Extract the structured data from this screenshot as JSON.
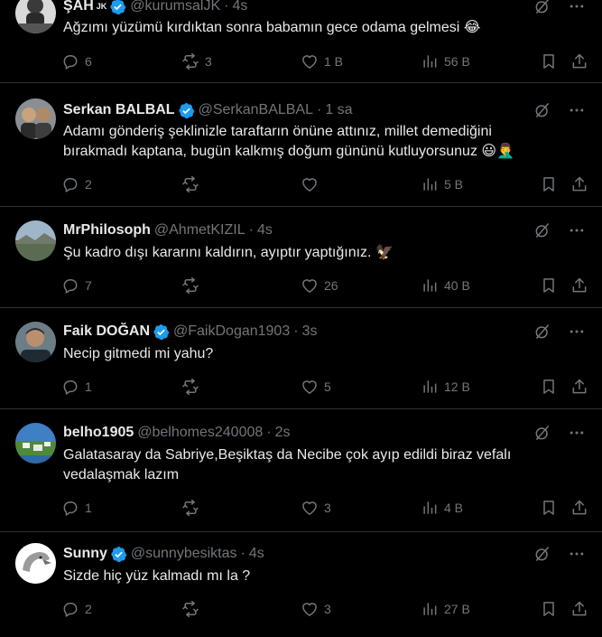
{
  "colors": {
    "background": "#000000",
    "text": "#e7e9ea",
    "muted": "#71767b",
    "verified": "#1d9bf0",
    "divider": "#2f3336"
  },
  "tweets": [
    {
      "name": "ŞAH",
      "name_badge": "JK",
      "handle": "@kurumsalJK",
      "time": "4s",
      "lines": [
        "Ağzımı yüzümü kırdıktan sonra babamın gece odama gelmesi 😂"
      ],
      "replies": "6",
      "retweets": "3",
      "likes": "1 B",
      "views": "56 B",
      "avatar_icon": "bearded-man-avatar"
    },
    {
      "name": "Serkan BALBAL",
      "handle": "@SerkanBALBAL",
      "time": "1 sa",
      "lines": [
        "Adamı gönderiş şeklinizle taraftarın önüne attınız, millet demediğini",
        "bırakmadı kaptana, bugün kalkmış doğum gününü kutluyorsunuz 😃🤦‍♂️"
      ],
      "replies": "2",
      "retweets": "",
      "likes": "",
      "views": "5 B",
      "avatar_icon": "two-men-avatar"
    },
    {
      "name": "MrPhilosoph",
      "handle": "@AhmetKIZIL",
      "time": "4s",
      "lines": [
        "Şu kadro dışı kararını kaldırın, ayıptır yaptığınız. 🦅"
      ],
      "replies": "7",
      "retweets": "",
      "likes": "26",
      "views": "40 B",
      "avatar_icon": "landscape-avatar"
    },
    {
      "name": "Faik DOĞAN",
      "handle": "@FaikDogan1903",
      "time": "3s",
      "lines": [
        "Necip gitmedi mi yahu?"
      ],
      "replies": "1",
      "retweets": "",
      "likes": "5",
      "views": "12 B",
      "avatar_icon": "man-portrait-avatar"
    },
    {
      "name": "belho1905",
      "handle": "@belhomes240008",
      "time": "2s",
      "lines": [
        "Galatasaray da Sabriye,Beşiktaş da Necibe çok ayıp edildi biraz vefalı",
        "vedalaşmak lazım"
      ],
      "replies": "1",
      "retweets": "",
      "likes": "3",
      "views": "4 B",
      "avatar_icon": "coastal-town-avatar"
    },
    {
      "name": "Sunny",
      "handle": "@sunnybesiktas",
      "time": "4s",
      "lines": [
        "Sizde hiç yüz kalmadı mı la ?"
      ],
      "replies": "2",
      "retweets": "",
      "likes": "3",
      "views": "27 B",
      "avatar_icon": "eagle-avatar"
    }
  ]
}
